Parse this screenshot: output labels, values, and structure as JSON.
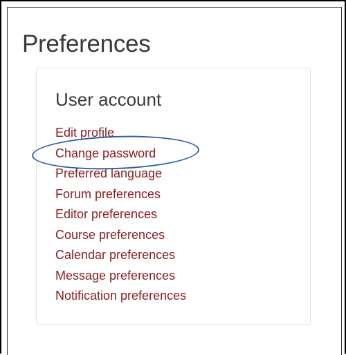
{
  "page": {
    "title": "Preferences"
  },
  "user_account": {
    "heading": "User account",
    "links": [
      {
        "label": "Edit profile"
      },
      {
        "label": "Change password"
      },
      {
        "label": "Preferred language"
      },
      {
        "label": "Forum preferences"
      },
      {
        "label": "Editor preferences"
      },
      {
        "label": "Course preferences"
      },
      {
        "label": "Calendar preferences"
      },
      {
        "label": "Message preferences"
      },
      {
        "label": "Notification preferences"
      }
    ],
    "highlighted_link": "Change password"
  },
  "colors": {
    "link": "#8a1e22",
    "heading": "#373a3c",
    "highlight_ellipse": "#2d5faa",
    "card_border": "#e1e1e1"
  }
}
